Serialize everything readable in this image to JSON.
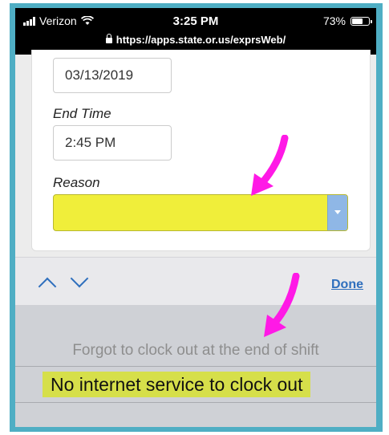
{
  "status_bar": {
    "carrier": "Verizon",
    "time": "3:25 PM",
    "battery": "73%",
    "battery_level": 0.73,
    "url": "https://apps.state.or.us/exprsWeb/"
  },
  "form": {
    "date_value": "03/13/2019",
    "end_time_label": "End Time",
    "end_time_value": "2:45 PM",
    "reason_label": "Reason",
    "reason_value": ""
  },
  "toolbar": {
    "done_label": "Done"
  },
  "picker": {
    "options": [
      "Forgot to clock out at the end of shift",
      "No internet service to clock out"
    ],
    "selected_index": 1
  },
  "colors": {
    "frame": "#4faec4",
    "highlight": "#f0ee3a",
    "annotation_arrow": "#ff19e6",
    "link": "#2f6fbd"
  },
  "icons": [
    "signal-icon",
    "wifi-icon",
    "battery-icon",
    "lock-icon",
    "chevron-up-icon",
    "chevron-down-icon",
    "select-arrow-icon",
    "annotation-arrow-icon"
  ]
}
